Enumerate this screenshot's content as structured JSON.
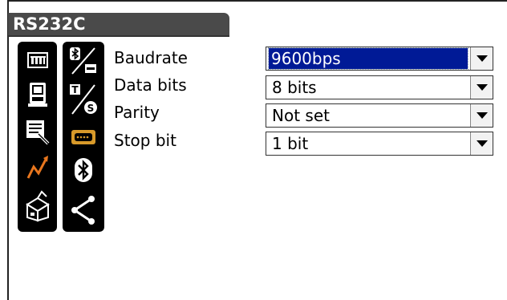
{
  "window": {
    "title": "RS232C"
  },
  "left_icons": [
    "instrument-menu-icon",
    "survey-instrument-icon",
    "data-editing-icon",
    "measurement-graph-icon",
    "storage-box-icon"
  ],
  "comm_icons": [
    "bluetooth-rs232c-toggle-icon",
    "t-s-toggle-icon",
    "rs232c-port-icon",
    "bluetooth-icon",
    "share-icon"
  ],
  "fields": [
    {
      "label": "Baudrate",
      "value": "9600bps",
      "selected": true
    },
    {
      "label": "Data bits",
      "value": "8 bits",
      "selected": false
    },
    {
      "label": "Parity",
      "value": "Not set",
      "selected": false
    },
    {
      "label": "Stop bit",
      "value": "1 bit",
      "selected": false
    }
  ],
  "colors": {
    "selection": "#001a96",
    "title_bar": "#4a4a4a",
    "accent_icon": "#e8761e",
    "port_icon": "#d89a2a"
  }
}
